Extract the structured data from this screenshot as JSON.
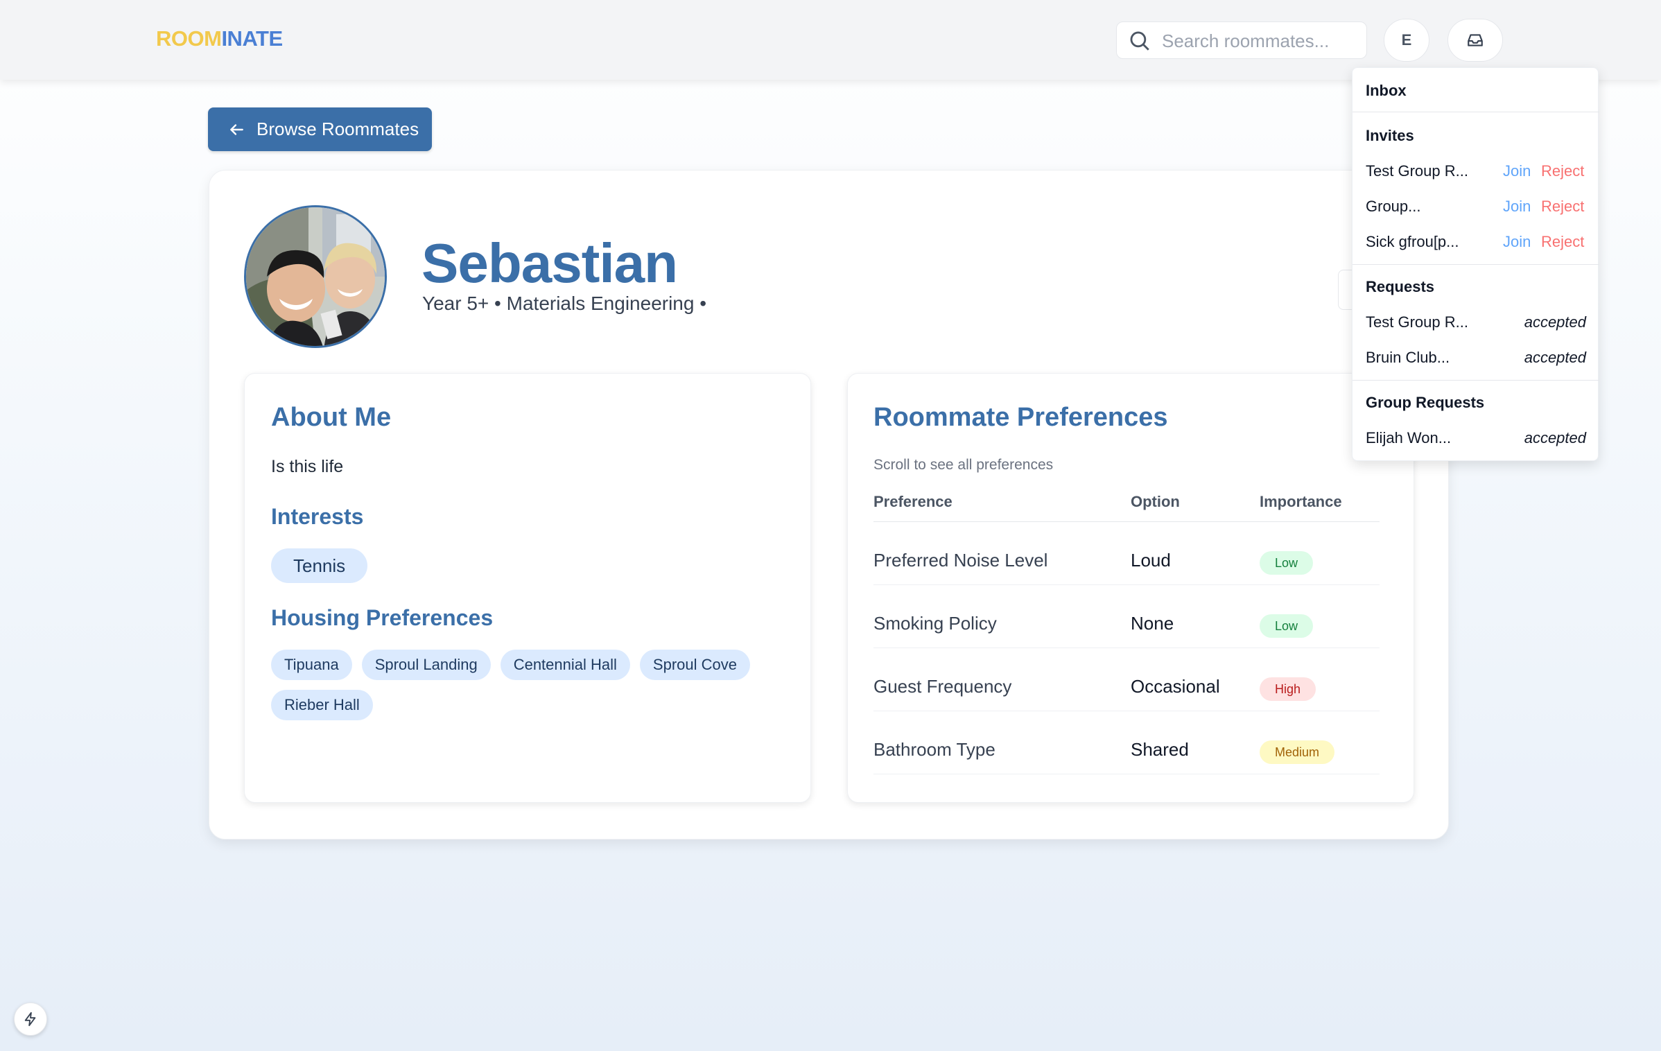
{
  "header": {
    "logo_part1": "ROOM",
    "logo_part2": "INATE",
    "search_placeholder": "Search roommates...",
    "avatar_initial": "E"
  },
  "back_button": {
    "label": "Browse Roommates"
  },
  "profile": {
    "name": "Sebastian",
    "subtitle": "Year 5+ • Materials Engineering •"
  },
  "about": {
    "title": "About Me",
    "text": "Is this life",
    "interests_title": "Interests",
    "interests": [
      "Tennis"
    ],
    "housing_title": "Housing Preferences",
    "housing": [
      "Tipuana",
      "Sproul Landing",
      "Centennial Hall",
      "Sproul Cove",
      "Rieber Hall"
    ]
  },
  "preferences": {
    "title": "Roommate Preferences",
    "hint": "Scroll to see all preferences",
    "columns": [
      "Preference",
      "Option",
      "Importance"
    ],
    "rows": [
      {
        "preference": "Preferred Noise Level",
        "option": "Loud",
        "importance": "Low"
      },
      {
        "preference": "Smoking Policy",
        "option": "None",
        "importance": "Low"
      },
      {
        "preference": "Guest Frequency",
        "option": "Occasional",
        "importance": "High"
      },
      {
        "preference": "Bathroom Type",
        "option": "Shared",
        "importance": "Medium"
      }
    ]
  },
  "inbox": {
    "title": "Inbox",
    "invites_title": "Invites",
    "invites": [
      {
        "name": "Test Group R...",
        "join": "Join",
        "reject": "Reject"
      },
      {
        "name": "Group...",
        "join": "Join",
        "reject": "Reject"
      },
      {
        "name": "Sick gfrou[p...",
        "join": "Join",
        "reject": "Reject"
      }
    ],
    "requests_title": "Requests",
    "requests": [
      {
        "name": "Test Group R...",
        "status": "accepted"
      },
      {
        "name": "Bruin Club...",
        "status": "accepted"
      }
    ],
    "group_requests_title": "Group Requests",
    "group_requests": [
      {
        "name": "Elijah Won...",
        "status": "accepted"
      }
    ]
  },
  "colors": {
    "brand_blue": "#3b6fa8",
    "logo_yellow": "#f2c94c",
    "logo_blue": "#4a7fd4",
    "join_blue": "#60a5fa",
    "reject_red": "#f87171"
  }
}
